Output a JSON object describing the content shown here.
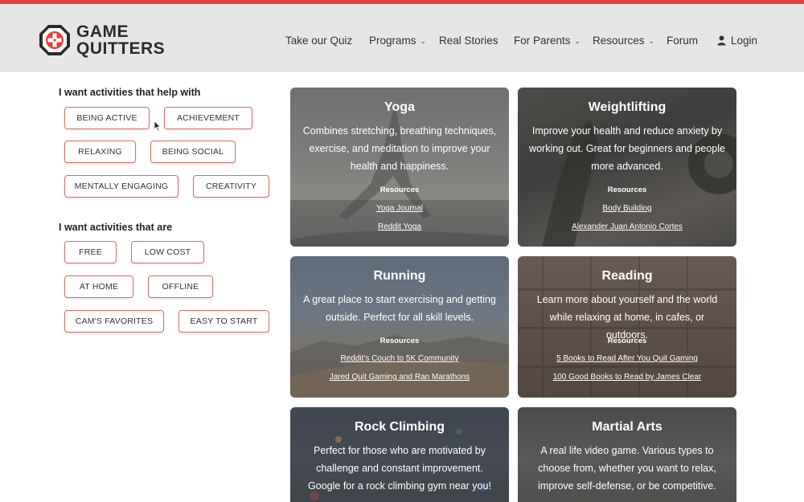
{
  "brand": {
    "line1": "GAME",
    "line2": "QUITTERS",
    "accent_color": "#e2423f"
  },
  "nav": {
    "quiz": "Take our Quiz",
    "programs": "Programs",
    "stories": "Real Stories",
    "parents": "For Parents",
    "resources": "Resources",
    "forum": "Forum",
    "login": "Login"
  },
  "filters": {
    "help_title": "I want activities that help with",
    "help_options": [
      "BEING ACTIVE",
      "ACHIEVEMENT",
      "RELAXING",
      "BEING SOCIAL",
      "MENTALLY ENGAGING",
      "CREATIVITY"
    ],
    "are_title": "I want activities that are",
    "are_options": [
      "FREE",
      "LOW COST",
      "AT HOME",
      "OFFLINE",
      "CAM'S FAVORITES",
      "EASY TO START"
    ]
  },
  "cards": [
    {
      "title": "Yoga",
      "desc": "Combines stretching, breathing techniques, exercise, and meditation to improve your health and happiness.",
      "resources_label": "Resources",
      "links": [
        "Yoga Journal",
        "Reddit Yoga"
      ]
    },
    {
      "title": "Weightlifting",
      "desc": "Improve your health and reduce anxiety by working out. Great for beginners and people more advanced.",
      "resources_label": "Resources",
      "links": [
        "Body Building",
        "Alexander Juan Antonio Cortes"
      ]
    },
    {
      "title": "Running",
      "desc": "A great place to start exercising and getting outside. Perfect for all skill levels.",
      "resources_label": "Resources",
      "links": [
        "Reddit's Couch to 5K Community",
        "Jared Quit Gaming and Ran Marathons"
      ]
    },
    {
      "title": "Reading",
      "desc": "Learn more about yourself and the world while relaxing at home, in cafes, or outdoors.",
      "resources_label": "Resources",
      "links": [
        "5 Books to Read After You Quit Gaming",
        "100 Good Books to Read by James Clear"
      ]
    },
    {
      "title": "Rock Climbing",
      "desc": "Perfect for those who are motivated by challenge and constant improvement. Google for a rock climbing gym near you!"
    },
    {
      "title": "Martial Arts",
      "desc": "A real life video game. Various types to choose from, whether you want to relax, improve self-defense, or be competitive."
    }
  ]
}
